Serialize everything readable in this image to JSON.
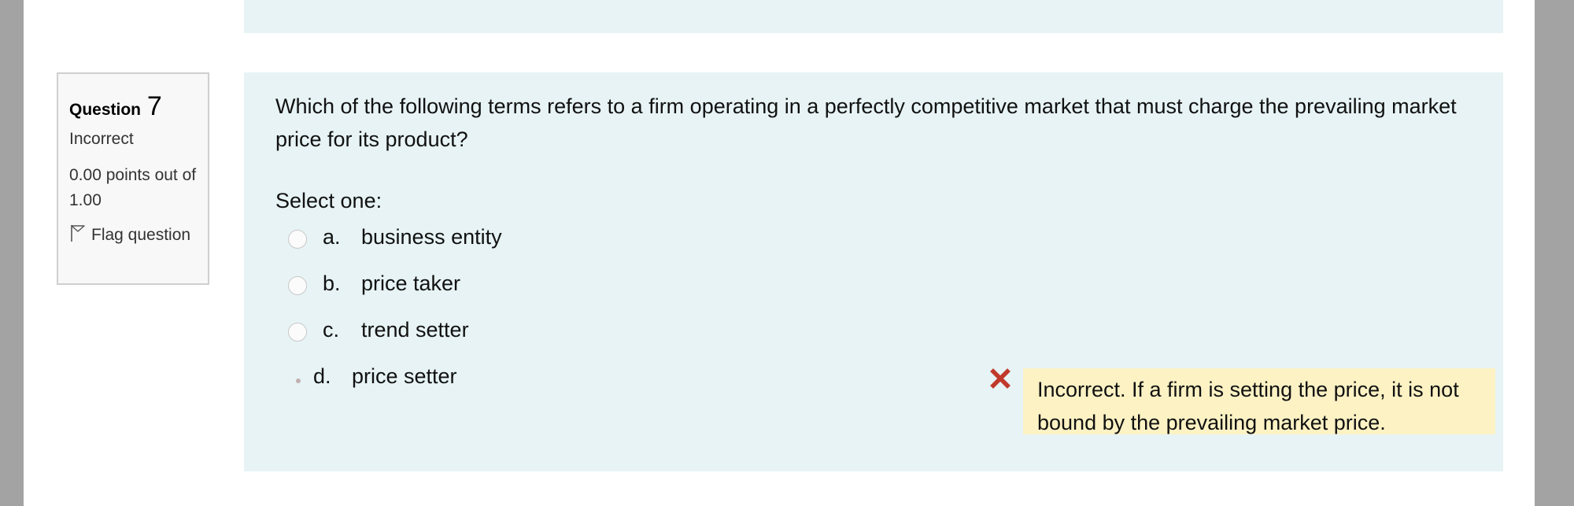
{
  "question": {
    "label": "Question",
    "number": "7",
    "state": "Incorrect",
    "grade": "0.00 points out of 1.00",
    "flag_label": "Flag question",
    "text": "Which of the following terms refers to a firm operating in a perfectly competitive market that must charge the prevailing market price for its product?",
    "prompt": "Select one:",
    "options": [
      {
        "letter": "a.",
        "text": "business entity"
      },
      {
        "letter": "b.",
        "text": "price taker"
      },
      {
        "letter": "c.",
        "text": "trend setter"
      },
      {
        "letter": "d.",
        "text": "price setter"
      }
    ],
    "feedback": "Incorrect. If a firm is setting the price, it is not bound by the prevailing market price."
  },
  "icons": {
    "flag": "flag-outline-icon",
    "incorrect": "red-x-icon"
  },
  "colors": {
    "content_bg": "#e7f3f5",
    "feedback_bg": "#fcf2c4",
    "incorrect_x": "#c0392b"
  }
}
